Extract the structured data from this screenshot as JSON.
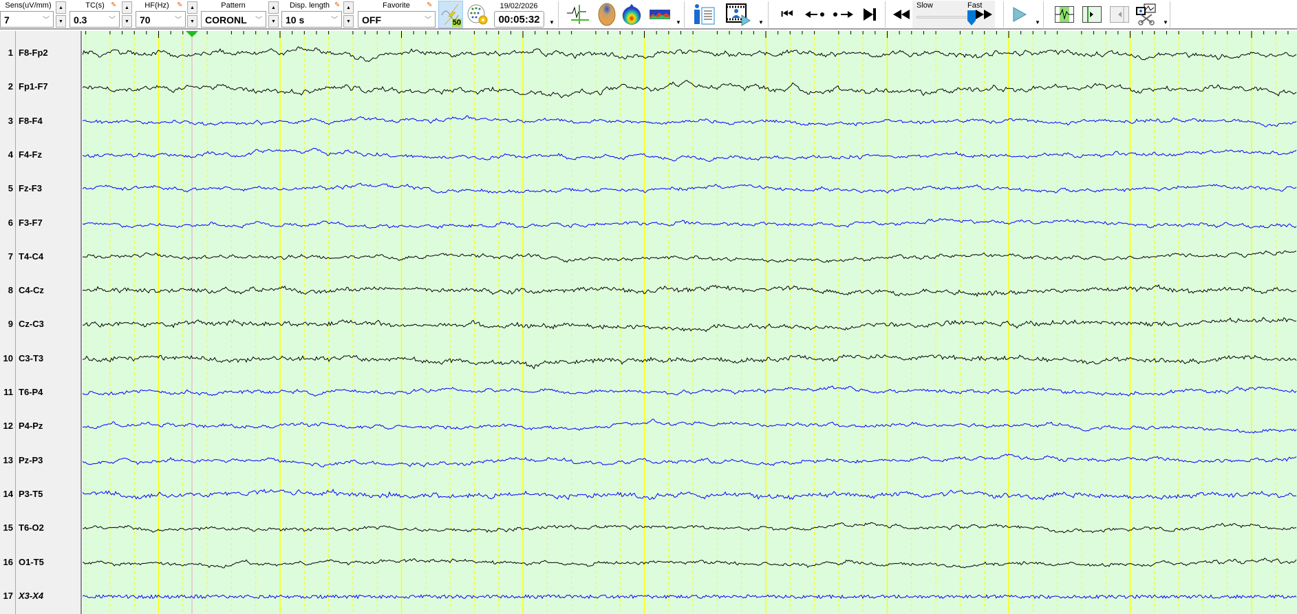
{
  "toolbar": {
    "sens": {
      "label": "Sens(uV/mm)",
      "value": "7"
    },
    "tc": {
      "label": "TC(s)",
      "value": "0.3"
    },
    "hf": {
      "label": "HF(Hz)",
      "value": "70"
    },
    "pattern": {
      "label": "Pattern",
      "value": "CORONL"
    },
    "disp_length": {
      "label": "Disp. length",
      "value": "10 s"
    },
    "favorite": {
      "label": "Favorite",
      "value": "OFF"
    },
    "notch_badge": "50",
    "date": "19/02/2026",
    "time": "00:05:32",
    "speed": {
      "slow_label": "Slow",
      "fast_label": "Fast",
      "value": 1.0
    }
  },
  "channels": [
    {
      "num": "1",
      "name": "F8-Fp2",
      "color": "#000000"
    },
    {
      "num": "2",
      "name": "Fp1-F7",
      "color": "#000000"
    },
    {
      "num": "3",
      "name": "F8-F4",
      "color": "#0000ff"
    },
    {
      "num": "4",
      "name": "F4-Fz",
      "color": "#0000ff"
    },
    {
      "num": "5",
      "name": "Fz-F3",
      "color": "#0000ff"
    },
    {
      "num": "6",
      "name": "F3-F7",
      "color": "#0000ff"
    },
    {
      "num": "7",
      "name": "T4-C4",
      "color": "#000000"
    },
    {
      "num": "8",
      "name": "C4-Cz",
      "color": "#000000"
    },
    {
      "num": "9",
      "name": "Cz-C3",
      "color": "#000000"
    },
    {
      "num": "10",
      "name": "C3-T3",
      "color": "#000000"
    },
    {
      "num": "11",
      "name": "T6-P4",
      "color": "#0000ff"
    },
    {
      "num": "12",
      "name": "P4-Pz",
      "color": "#0000ff"
    },
    {
      "num": "13",
      "name": "Pz-P3",
      "color": "#0000ff"
    },
    {
      "num": "14",
      "name": "P3-T5",
      "color": "#0000ff"
    },
    {
      "num": "15",
      "name": "T6-O2",
      "color": "#000000"
    },
    {
      "num": "16",
      "name": "O1-T5",
      "color": "#000000"
    },
    {
      "num": "17",
      "name": "X3-X4",
      "color": "#0000ff"
    }
  ],
  "colors": {
    "background": "#dcfcdc",
    "second_line": "#ffff00",
    "cursor": "#f0a0c8",
    "marker": "#22bb22"
  }
}
